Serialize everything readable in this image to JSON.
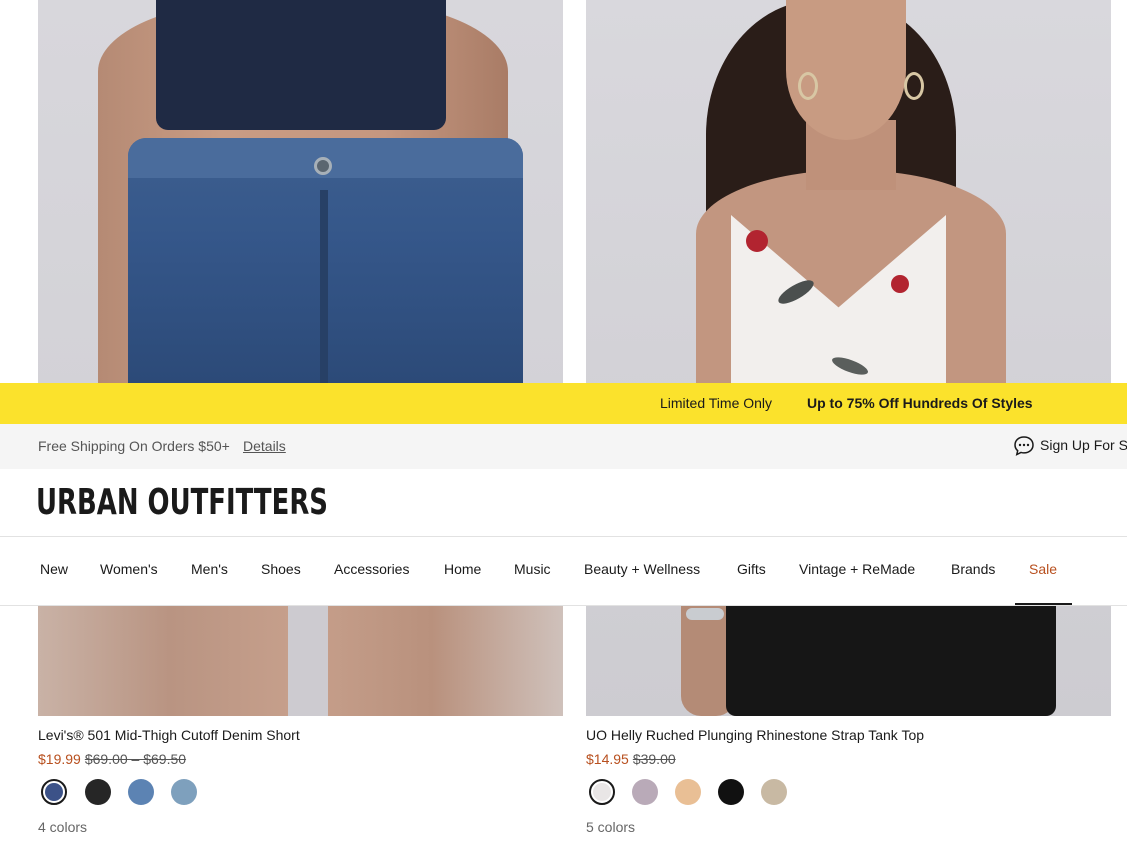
{
  "promo": {
    "label": "Limited Time Only",
    "offer": "Up to 75% Off Hundreds Of Styles",
    "background": "#fbe22c"
  },
  "shipping": {
    "text": "Free Shipping On Orders $50+",
    "link": "Details",
    "signup": "Sign Up For S"
  },
  "header": {
    "logo": "URBAN OUTFITTERS"
  },
  "nav": {
    "items": [
      "New",
      "Women's",
      "Men's",
      "Shoes",
      "Accessories",
      "Home",
      "Music",
      "Beauty + Wellness",
      "Gifts",
      "Vintage + ReMade",
      "Brands",
      "Sale"
    ],
    "accent": "#b8501f"
  },
  "products": [
    {
      "title": "Levi's® 501 Mid-Thigh Cutoff Denim Short",
      "price": "$19.99",
      "original_price": "$69.00 – $69.50",
      "colors_label": "4 colors",
      "swatches": [
        "#3c5288",
        "#262626",
        "#5c83b3",
        "#7ea0bd"
      ]
    },
    {
      "title": "UO Helly Ruched Plunging Rhinestone Strap Tank Top",
      "price": "$14.95",
      "original_price": "$39.00",
      "colors_label": "5 colors",
      "swatches": [
        "#e9e6e6",
        "#b9aab8",
        "#e9bf95",
        "#111111",
        "#c8b9a3"
      ]
    }
  ]
}
